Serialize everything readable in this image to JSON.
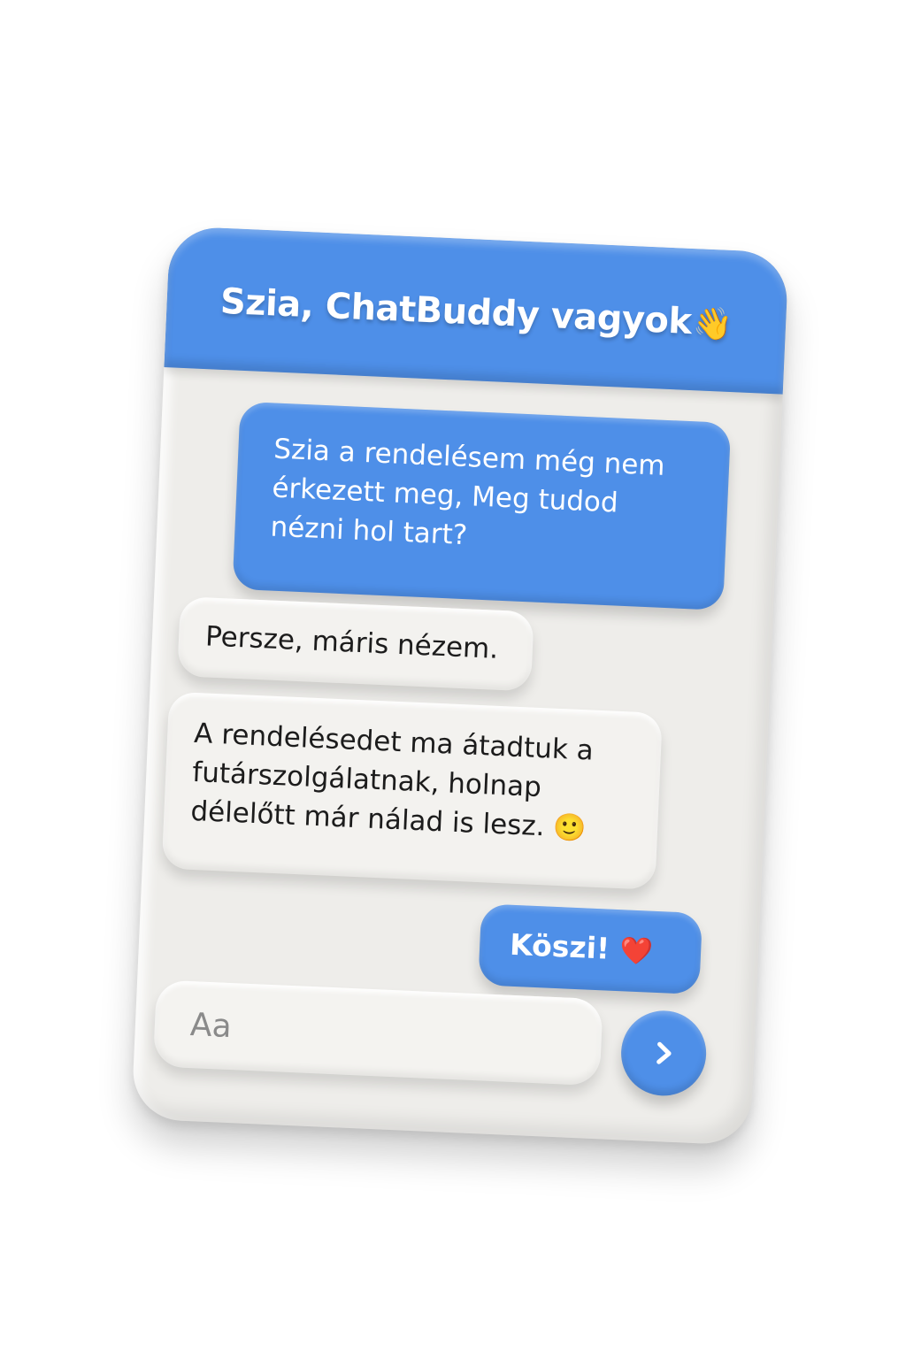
{
  "header": {
    "title": "Szia, ChatBuddy vagyok",
    "title_icon": "waving-hand-icon"
  },
  "messages": [
    {
      "sender": "user",
      "text": "Szia a rendelésem még nem érkezett meg, Meg tudod nézni hol tart?"
    },
    {
      "sender": "bot",
      "text": "Persze, máris nézem."
    },
    {
      "sender": "bot",
      "text": "A rendelésedet ma átadtuk a futárszolgálatnak, holnap délelőtt már nálad is lesz.",
      "emoji": "🙂",
      "emoji_icon": "smiling-face-icon"
    },
    {
      "sender": "user",
      "text": "Köszi!",
      "emoji": "❤️",
      "emoji_icon": "red-heart-icon"
    }
  ],
  "composer": {
    "placeholder": "Aa",
    "value": ""
  },
  "send": {
    "icon": "chevron-right-icon"
  },
  "colors": {
    "accent": "#4e8fe8",
    "card_bg": "#eeedea",
    "bot_bubble": "#f3f2ef",
    "bot_text": "#1c1c1c",
    "user_text": "#ffffff"
  }
}
